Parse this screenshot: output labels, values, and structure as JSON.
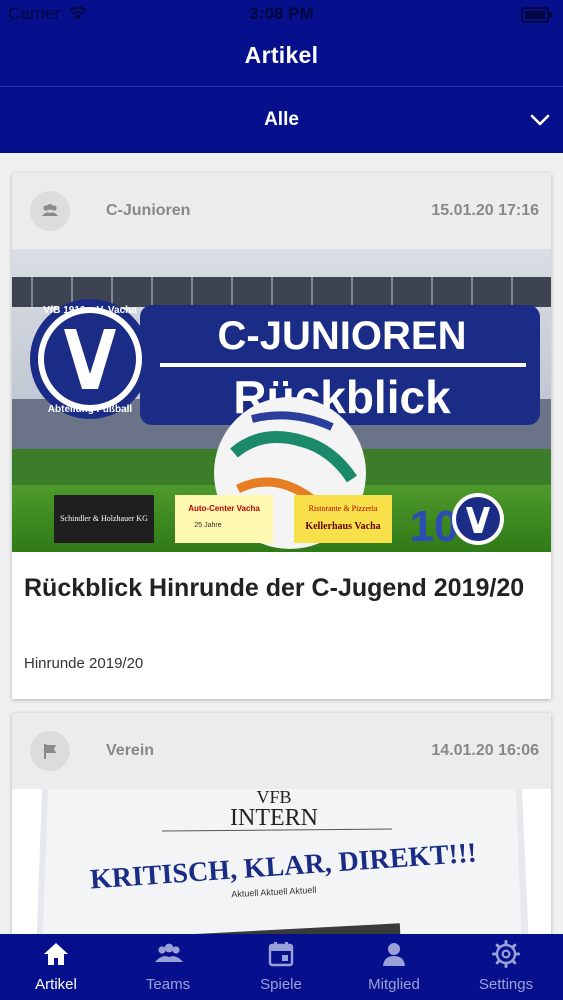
{
  "status_bar": {
    "carrier": "Carrier",
    "time": "3:08 PM"
  },
  "header": {
    "title": "Artikel",
    "filter_label": "Alle"
  },
  "articles": [
    {
      "category": "C-Junioren",
      "category_icon": "group-icon",
      "date": "15.01.20 17:16",
      "image": {
        "club_name": "VfB 1919 e.V. Vacha",
        "club_sub": "Abteilung Fußball",
        "banner_line1": "C-JUNIOREN",
        "banner_line2": "Rückblick",
        "sponsors": [
          "Schindler & Holzhauer KG",
          "Auto-Center Vacha",
          "25 Jahre",
          "Ristorante & Pizzeria",
          "Kellerhaus Vacha",
          "10"
        ]
      },
      "title": "Rückblick Hinrunde der C-Jugend 2019/20",
      "subtitle": "Hinrunde 2019/20"
    },
    {
      "category": "Verein",
      "category_icon": "flag-icon",
      "date": "14.01.20 16:06",
      "image": {
        "paper_name1": "VFB",
        "paper_name2": "INTERN",
        "headline": "KRITISCH, KLAR, DIREKT!!!",
        "tagline": "Aktuell Aktuell Aktuell"
      }
    }
  ],
  "tabs": [
    {
      "label": "Artikel",
      "icon": "home-icon",
      "active": true
    },
    {
      "label": "Teams",
      "icon": "teams-icon",
      "active": false
    },
    {
      "label": "Spiele",
      "icon": "calendar-icon",
      "active": false
    },
    {
      "label": "Mitglied",
      "icon": "person-icon",
      "active": false
    },
    {
      "label": "Settings",
      "icon": "gear-icon",
      "active": false
    }
  ],
  "colors": {
    "primary": "#06108c",
    "tab_inactive": "#9aa1d8",
    "card_header": "#ececec"
  }
}
